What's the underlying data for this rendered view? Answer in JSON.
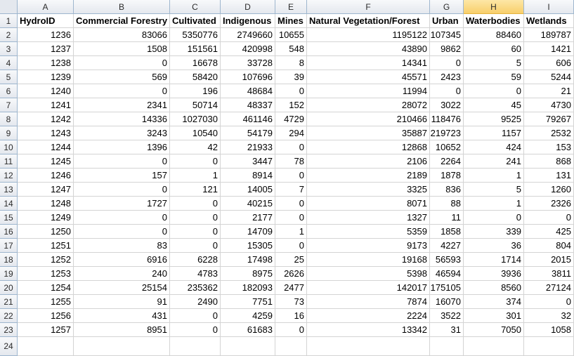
{
  "column_letters": [
    "A",
    "B",
    "C",
    "D",
    "E",
    "F",
    "G",
    "H",
    "I"
  ],
  "selected_column": "H",
  "row_numbers": [
    "1",
    "2",
    "3",
    "4",
    "5",
    "6",
    "7",
    "8",
    "9",
    "10",
    "11",
    "12",
    "13",
    "14",
    "15",
    "16",
    "17",
    "18",
    "19",
    "20",
    "21",
    "22",
    "23",
    "24"
  ],
  "header": [
    "HydroID",
    "Commercial Forestry",
    "Cultivated",
    "Indigenous",
    "Mines",
    "Natural Vegetation/Forest",
    "Urban",
    "Waterbodies",
    "Wetlands"
  ],
  "rows": [
    [
      "1236",
      "83066",
      "5350776",
      "2749660",
      "10655",
      "1195122",
      "107345",
      "88460",
      "189787"
    ],
    [
      "1237",
      "1508",
      "151561",
      "420998",
      "548",
      "43890",
      "9862",
      "60",
      "1421"
    ],
    [
      "1238",
      "0",
      "16678",
      "33728",
      "8",
      "14341",
      "0",
      "5",
      "606"
    ],
    [
      "1239",
      "569",
      "58420",
      "107696",
      "39",
      "45571",
      "2423",
      "59",
      "5244"
    ],
    [
      "1240",
      "0",
      "196",
      "48684",
      "0",
      "11994",
      "0",
      "0",
      "21"
    ],
    [
      "1241",
      "2341",
      "50714",
      "48337",
      "152",
      "28072",
      "3022",
      "45",
      "4730"
    ],
    [
      "1242",
      "14336",
      "1027030",
      "461146",
      "4729",
      "210466",
      "118476",
      "9525",
      "79267"
    ],
    [
      "1243",
      "3243",
      "10540",
      "54179",
      "294",
      "35887",
      "219723",
      "1157",
      "2532"
    ],
    [
      "1244",
      "1396",
      "42",
      "21933",
      "0",
      "12868",
      "10652",
      "424",
      "153"
    ],
    [
      "1245",
      "0",
      "0",
      "3447",
      "78",
      "2106",
      "2264",
      "241",
      "868"
    ],
    [
      "1246",
      "157",
      "1",
      "8914",
      "0",
      "2189",
      "1878",
      "1",
      "131"
    ],
    [
      "1247",
      "0",
      "121",
      "14005",
      "7",
      "3325",
      "836",
      "5",
      "1260"
    ],
    [
      "1248",
      "1727",
      "0",
      "40215",
      "0",
      "8071",
      "88",
      "1",
      "2326"
    ],
    [
      "1249",
      "0",
      "0",
      "2177",
      "0",
      "1327",
      "11",
      "0",
      "0"
    ],
    [
      "1250",
      "0",
      "0",
      "14709",
      "1",
      "5359",
      "1858",
      "339",
      "425"
    ],
    [
      "1251",
      "83",
      "0",
      "15305",
      "0",
      "9173",
      "4227",
      "36",
      "804"
    ],
    [
      "1252",
      "6916",
      "6228",
      "17498",
      "25",
      "19168",
      "56593",
      "1714",
      "2015"
    ],
    [
      "1253",
      "240",
      "4783",
      "8975",
      "2626",
      "5398",
      "46594",
      "3936",
      "3811"
    ],
    [
      "1254",
      "25154",
      "235362",
      "182093",
      "2477",
      "142017",
      "175105",
      "8560",
      "27124"
    ],
    [
      "1255",
      "91",
      "2490",
      "7751",
      "73",
      "7874",
      "16070",
      "374",
      "0"
    ],
    [
      "1256",
      "431",
      "0",
      "4259",
      "16",
      "2224",
      "3522",
      "301",
      "32"
    ],
    [
      "1257",
      "8951",
      "0",
      "61683",
      "0",
      "13342",
      "31",
      "7050",
      "1058"
    ],
    [
      "",
      "",
      "",
      "",
      "",
      "",
      "",
      "",
      ""
    ]
  ],
  "colors": {
    "header_bg": "#e4e8ee",
    "selected_header_bg": "#f8cf6b",
    "gridline": "#d4d4d4",
    "header_border": "#9eb6ce"
  }
}
